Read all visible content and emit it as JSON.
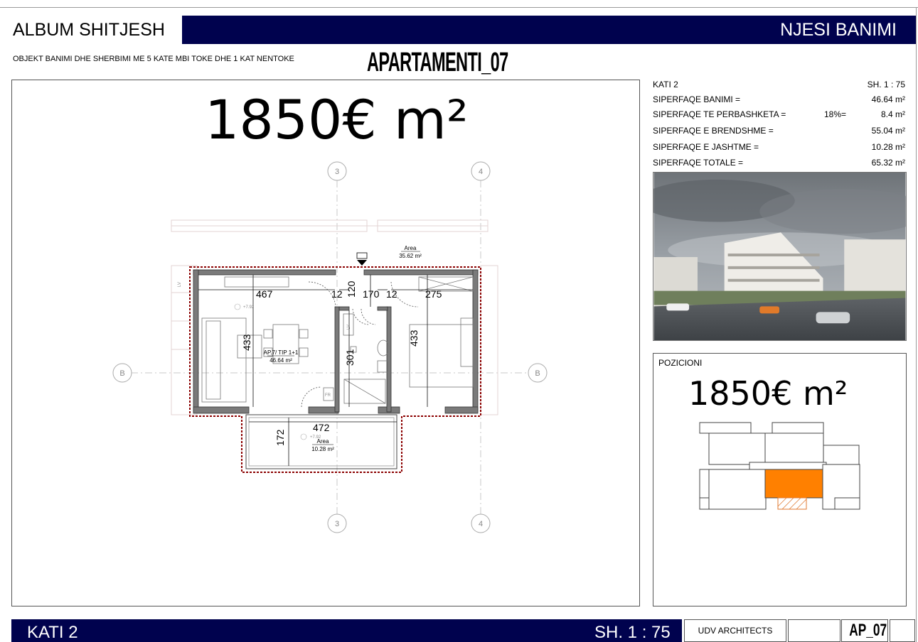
{
  "header": {
    "album_title": "ALBUM SHITJESH",
    "section_title": "NJESI BANIMI",
    "subtitle": "OBJEKT BANIMI DHE SHERBIMI ME 5 KATE MBI TOKE DHE 1 KAT NENTOKE",
    "apartment_title": "APARTAMENTI_07"
  },
  "price": "1850€ m²",
  "plan": {
    "grid_labels": [
      "3",
      "4",
      "B"
    ],
    "dimensions": [
      "467",
      "12",
      "120",
      "170",
      "12",
      "275",
      "433",
      "301",
      "433",
      "472",
      "172"
    ],
    "room_label": "AP.7/ TIP 1+1",
    "room_area": "46.64 m²",
    "top_area_label": "Area",
    "top_area_value": "35.62 m²",
    "balcony_area_label": "Area",
    "balcony_area_value": "10.28 m²",
    "level_marks": [
      "+7.92",
      "+7.92"
    ],
    "tags": [
      "LV",
      "LV",
      "FR"
    ]
  },
  "info": {
    "floor": "KATI 2",
    "scale": "SH. 1 : 75",
    "rows": [
      {
        "label": "SIPERFAQE BANIMI =",
        "pct": "",
        "value": "46.64 m²"
      },
      {
        "label": "SIPERFAQE TE PERBASHKETA =",
        "pct": "18%=",
        "value": "8.4 m²"
      },
      {
        "label": "SIPERFAQE E BRENDSHME =",
        "pct": "",
        "value": "55.04 m²"
      },
      {
        "label": "SIPERFAQE E JASHTME =",
        "pct": "",
        "value": "10.28 m²"
      },
      {
        "label": "SIPERFAQE TOTALE  =",
        "pct": "",
        "value": "65.32 m²"
      }
    ]
  },
  "position": {
    "label": "POZICIONI",
    "price": "1850€ m²",
    "highlight_color": "#ff8000"
  },
  "footer": {
    "floor": "KATI 2",
    "scale": "SH. 1 : 75",
    "firm": "UDV ARCHITECTS",
    "sheet": "AP_07"
  },
  "colors": {
    "bar": "#00024e",
    "outline_red": "#8b0000"
  }
}
